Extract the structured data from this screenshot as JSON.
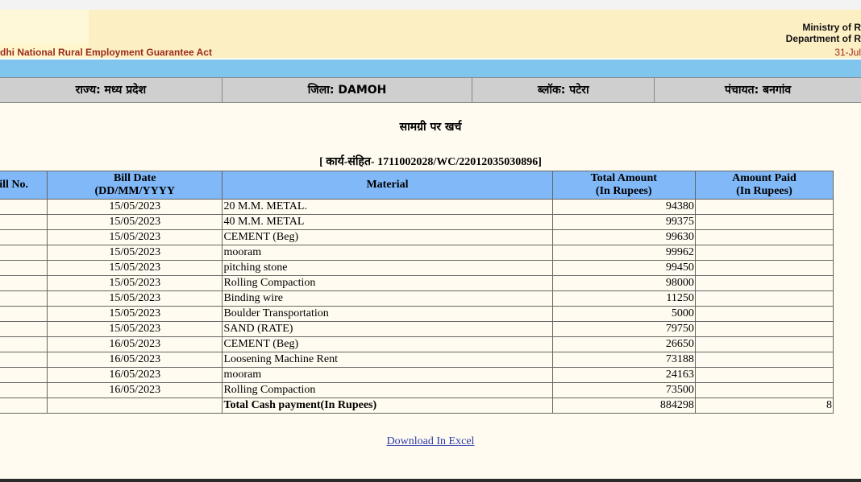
{
  "header": {
    "act_title": "dhi National Rural Employment Guarantee Act",
    "ministry": "Ministry of R",
    "department": "Department of R",
    "date": "31-Jul"
  },
  "location": {
    "state": "राज्य: मध्य प्रदेश",
    "district": "जिला: DAMOH",
    "block": "ब्लॉक: पटेरा",
    "panchayat": "पंचायत: बनगांव"
  },
  "page_title": "सामग्री पर खर्च",
  "work_code": "[ कार्य-संहित- 1711002028/WC/22012035030896]",
  "table": {
    "headers": {
      "bill_no": "Bill No.",
      "bill_date_1": "Bill Date",
      "bill_date_2": "(DD/MM/YYYY",
      "material": "Material",
      "total_amount_1": "Total Amount",
      "total_amount_2": "(In Rupees)",
      "amount_paid_1": "Amount Paid",
      "amount_paid_2": "(In Rupees)"
    },
    "rows": [
      {
        "date": "15/05/2023",
        "material": "20 M.M. METAL.",
        "amount": "94380"
      },
      {
        "date": "15/05/2023",
        "material": "40 M.M. METAL",
        "amount": "99375"
      },
      {
        "date": "15/05/2023",
        "material": "CEMENT (Beg)",
        "amount": "99630"
      },
      {
        "date": "15/05/2023",
        "material": "mooram",
        "amount": "99962"
      },
      {
        "date": "15/05/2023",
        "material": "pitching stone",
        "amount": "99450"
      },
      {
        "date": "15/05/2023",
        "material": "Rolling Compaction",
        "amount": "98000"
      },
      {
        "date": "15/05/2023",
        "material": "Binding wire",
        "amount": "11250"
      },
      {
        "date": "15/05/2023",
        "material": "Boulder Transportation",
        "amount": "5000"
      },
      {
        "date": "15/05/2023",
        "material": "SAND (RATE)",
        "amount": "79750"
      },
      {
        "date": "16/05/2023",
        "material": "CEMENT (Beg)",
        "amount": "26650"
      },
      {
        "date": "16/05/2023",
        "material": "Loosening Machine Rent",
        "amount": "73188"
      },
      {
        "date": "16/05/2023",
        "material": "mooram",
        "amount": "24163"
      },
      {
        "date": "16/05/2023",
        "material": "Rolling Compaction",
        "amount": "73500"
      }
    ],
    "total": {
      "label": "Total Cash payment(In Rupees)",
      "amount": "884298",
      "paid": "8"
    }
  },
  "download_link": "Download In Excel"
}
